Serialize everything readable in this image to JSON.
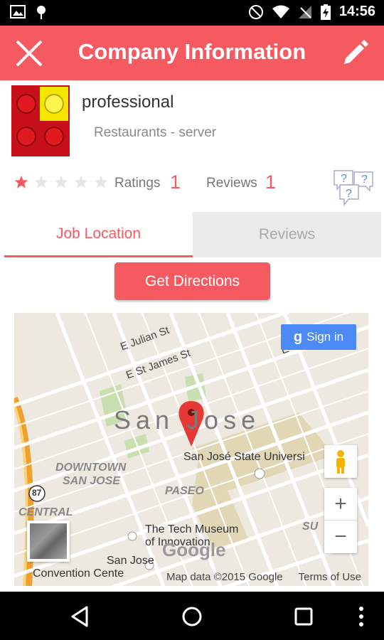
{
  "status_bar": {
    "time": "14:56"
  },
  "app_bar": {
    "title": "Company Information"
  },
  "company": {
    "name": "professional",
    "category": "Restaurants - server"
  },
  "ratings": {
    "stars_filled": 1,
    "stars_total": 5,
    "ratings_label": "Ratings",
    "ratings_count": "1",
    "reviews_label": "Reviews",
    "reviews_count": "1"
  },
  "tabs": [
    {
      "label": "Job Location",
      "active": true
    },
    {
      "label": "Reviews",
      "active": false
    }
  ],
  "actions": {
    "directions_label": "Get Directions"
  },
  "map": {
    "sign_in_label": "Sign in",
    "city_label": "San Jose",
    "streets": [
      "E Julian St",
      "E St James St",
      "E Sa"
    ],
    "districts": [
      "DOWNTOWN",
      "SAN JOSE",
      "PASEO",
      "CENTRAL",
      "SU"
    ],
    "pois": [
      "San José State Universi",
      "The Tech Museum",
      "of Innovation",
      "San Jose",
      "Convention Cente"
    ],
    "highway_shield": "87",
    "google_logo": "Google",
    "footer_data": "Map data ©2015 Google",
    "footer_terms": "Terms of Use",
    "zoom_in": "+",
    "zoom_out": "−"
  },
  "colors": {
    "accent": "#f65a61",
    "map_bg": "#ede9e1",
    "signin": "#4c8bf5"
  }
}
